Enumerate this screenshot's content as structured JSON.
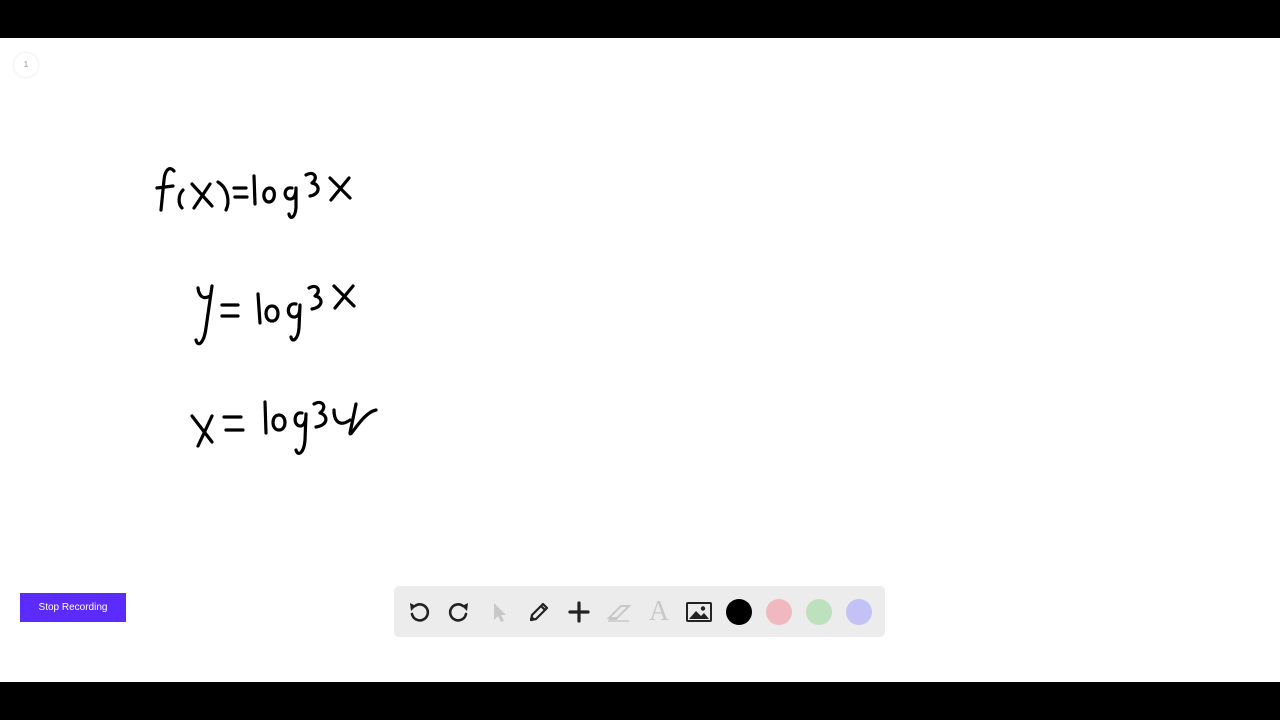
{
  "page_indicator": "1",
  "handwriting": {
    "lines": [
      "f(x)=log3x",
      "y= log 3x",
      "x = log3y"
    ]
  },
  "stop_button": {
    "label": "Stop Recording"
  },
  "toolbar": {
    "tools": [
      {
        "name": "undo-icon",
        "enabled": true
      },
      {
        "name": "redo-icon",
        "enabled": true
      },
      {
        "name": "select-pointer-icon",
        "enabled": false
      },
      {
        "name": "pencil-icon",
        "enabled": true
      },
      {
        "name": "add-icon",
        "enabled": true
      },
      {
        "name": "eraser-icon",
        "enabled": false
      },
      {
        "name": "text-icon",
        "enabled": false
      },
      {
        "name": "image-icon",
        "enabled": true
      }
    ],
    "text_tool_glyph": "A",
    "colors": [
      {
        "name": "black",
        "hex": "#000000",
        "selected": true
      },
      {
        "name": "pink",
        "hex": "#f2b8bf",
        "selected": false
      },
      {
        "name": "green",
        "hex": "#bde0bd",
        "selected": false
      },
      {
        "name": "lavender",
        "hex": "#c2c2f7",
        "selected": false
      }
    ]
  },
  "colors": {
    "stop_button_bg": "#5b2bff",
    "toolbar_bg": "#ececec",
    "canvas_bg": "#ffffff"
  }
}
